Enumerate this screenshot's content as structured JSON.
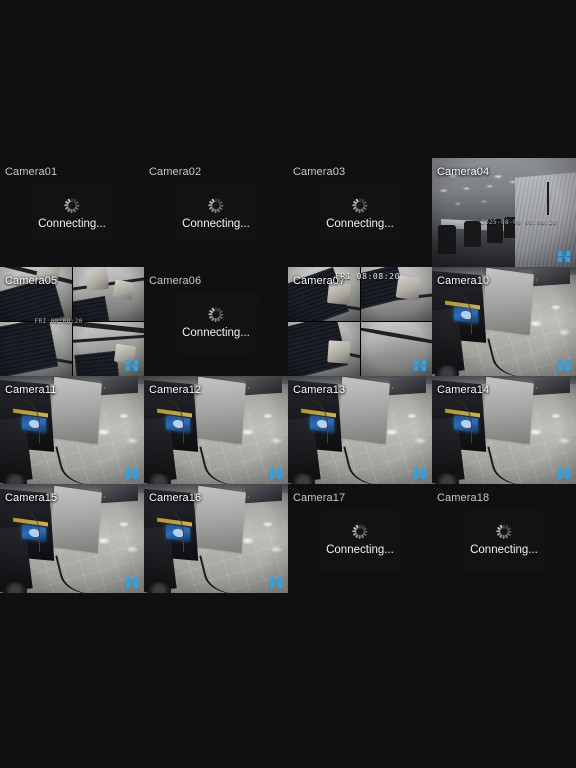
{
  "app": {
    "background_color": "#101011",
    "watermark_color": "#22a6f0",
    "grid": {
      "columns": 4,
      "rows": 4
    }
  },
  "status": {
    "connecting_label": "Connecting...",
    "spinner_name": "loading-spinner"
  },
  "osd": {
    "camera07_timestamp": "FRI  08:08:20",
    "camera05_timestamp": "FRI 08:08:20",
    "camera04_timestamp": "2025-08-08 08:08:20"
  },
  "cameras": [
    {
      "id": "cam01",
      "label": "Camera01",
      "state": "connecting",
      "scene": "none"
    },
    {
      "id": "cam02",
      "label": "Camera02",
      "state": "connecting",
      "scene": "none"
    },
    {
      "id": "cam03",
      "label": "Camera03",
      "state": "connecting",
      "scene": "none"
    },
    {
      "id": "cam04",
      "label": "Camera04",
      "state": "live",
      "scene": "office"
    },
    {
      "id": "cam05",
      "label": "Camera05",
      "state": "live",
      "scene": "roof-quad"
    },
    {
      "id": "cam06",
      "label": "Camera06",
      "state": "connecting",
      "scene": "none"
    },
    {
      "id": "cam07",
      "label": "Camera07",
      "state": "live",
      "scene": "roof-quad"
    },
    {
      "id": "cam10",
      "label": "Camera10",
      "state": "live",
      "scene": "lab"
    },
    {
      "id": "cam11",
      "label": "Camera11",
      "state": "live",
      "scene": "lab"
    },
    {
      "id": "cam12",
      "label": "Camera12",
      "state": "live",
      "scene": "lab"
    },
    {
      "id": "cam13",
      "label": "Camera13",
      "state": "live",
      "scene": "lab"
    },
    {
      "id": "cam14",
      "label": "Camera14",
      "state": "live",
      "scene": "lab"
    },
    {
      "id": "cam15",
      "label": "Camera15",
      "state": "live",
      "scene": "lab"
    },
    {
      "id": "cam16",
      "label": "Camera16",
      "state": "live",
      "scene": "lab"
    },
    {
      "id": "cam17",
      "label": "Camera17",
      "state": "connecting",
      "scene": "none"
    },
    {
      "id": "cam18",
      "label": "Camera18",
      "state": "connecting",
      "scene": "none"
    }
  ]
}
